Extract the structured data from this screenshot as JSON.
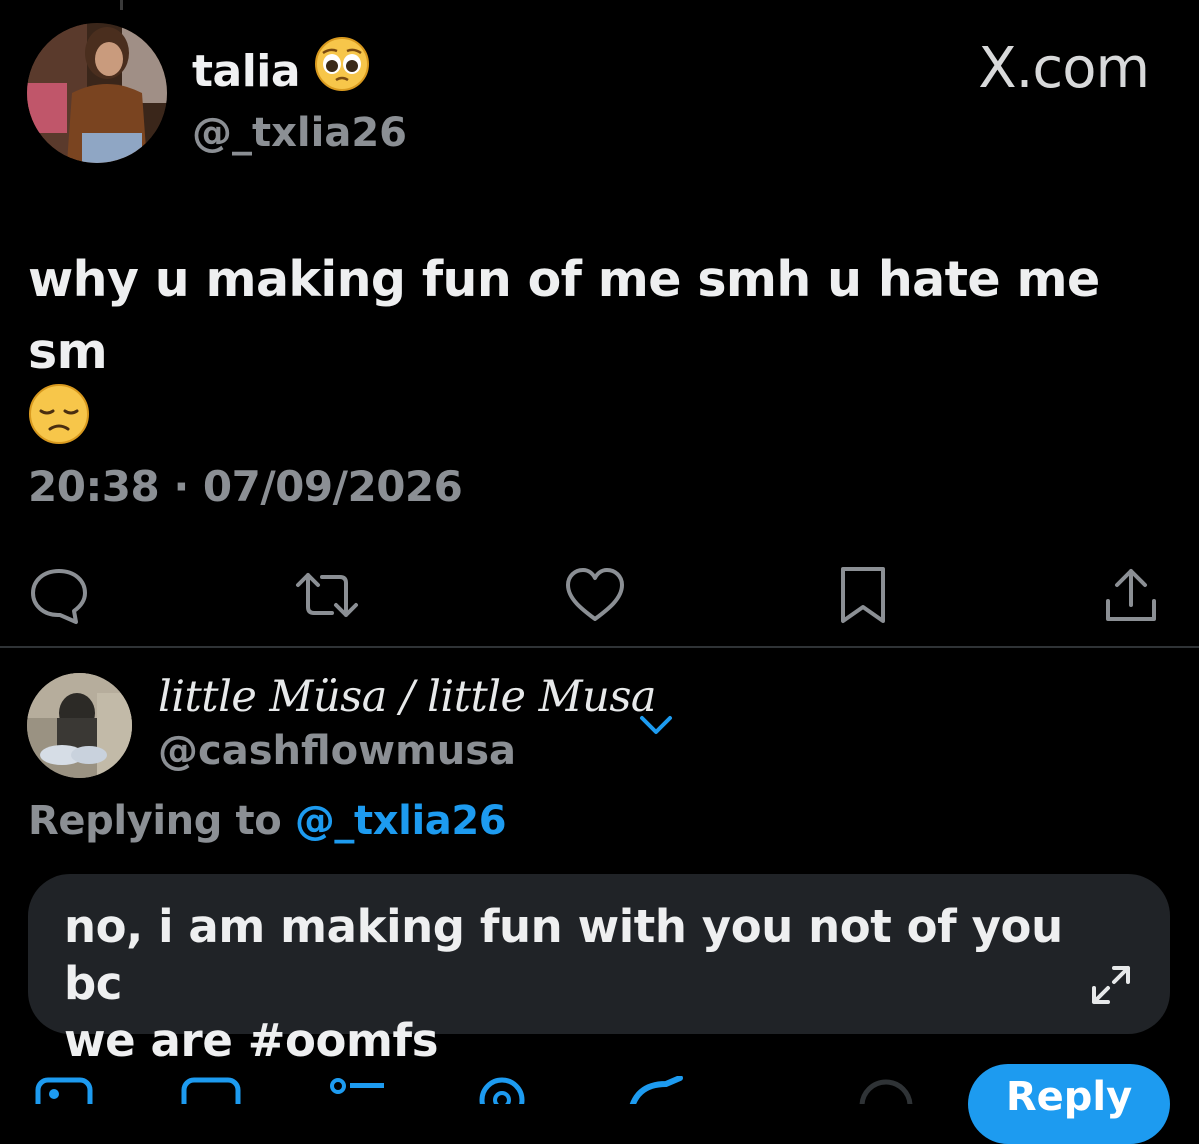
{
  "tweet": {
    "author_name": "talia",
    "author_emoji": "pleading-face",
    "author_handle": "@_txlia26",
    "watermark": "X.com",
    "text": "why u making fun of me smh u hate me sm",
    "text_emoji": "disappointed-face",
    "timestamp": "20:38 · 07/09/2026"
  },
  "actions": [
    {
      "name": "reply",
      "icon": "comment-icon"
    },
    {
      "name": "repost",
      "icon": "repost-icon"
    },
    {
      "name": "like",
      "icon": "heart-icon"
    },
    {
      "name": "bookmark",
      "icon": "bookmark-icon"
    },
    {
      "name": "share",
      "icon": "share-icon"
    }
  ],
  "reply": {
    "author_name": "little Müsa / little Musa",
    "author_handle": "@cashflowmusa",
    "replying_prefix": "Replying to",
    "replying_to": "@_txlia26",
    "draft_line1": "no, i am making fun with you not of you bc",
    "draft_line2": "we are #oomfs",
    "submit_label": "Reply"
  },
  "colors": {
    "background": "#000000",
    "accent": "#1d9bf0",
    "muted_text": "#8b8f94",
    "compose_bg": "#202327"
  }
}
